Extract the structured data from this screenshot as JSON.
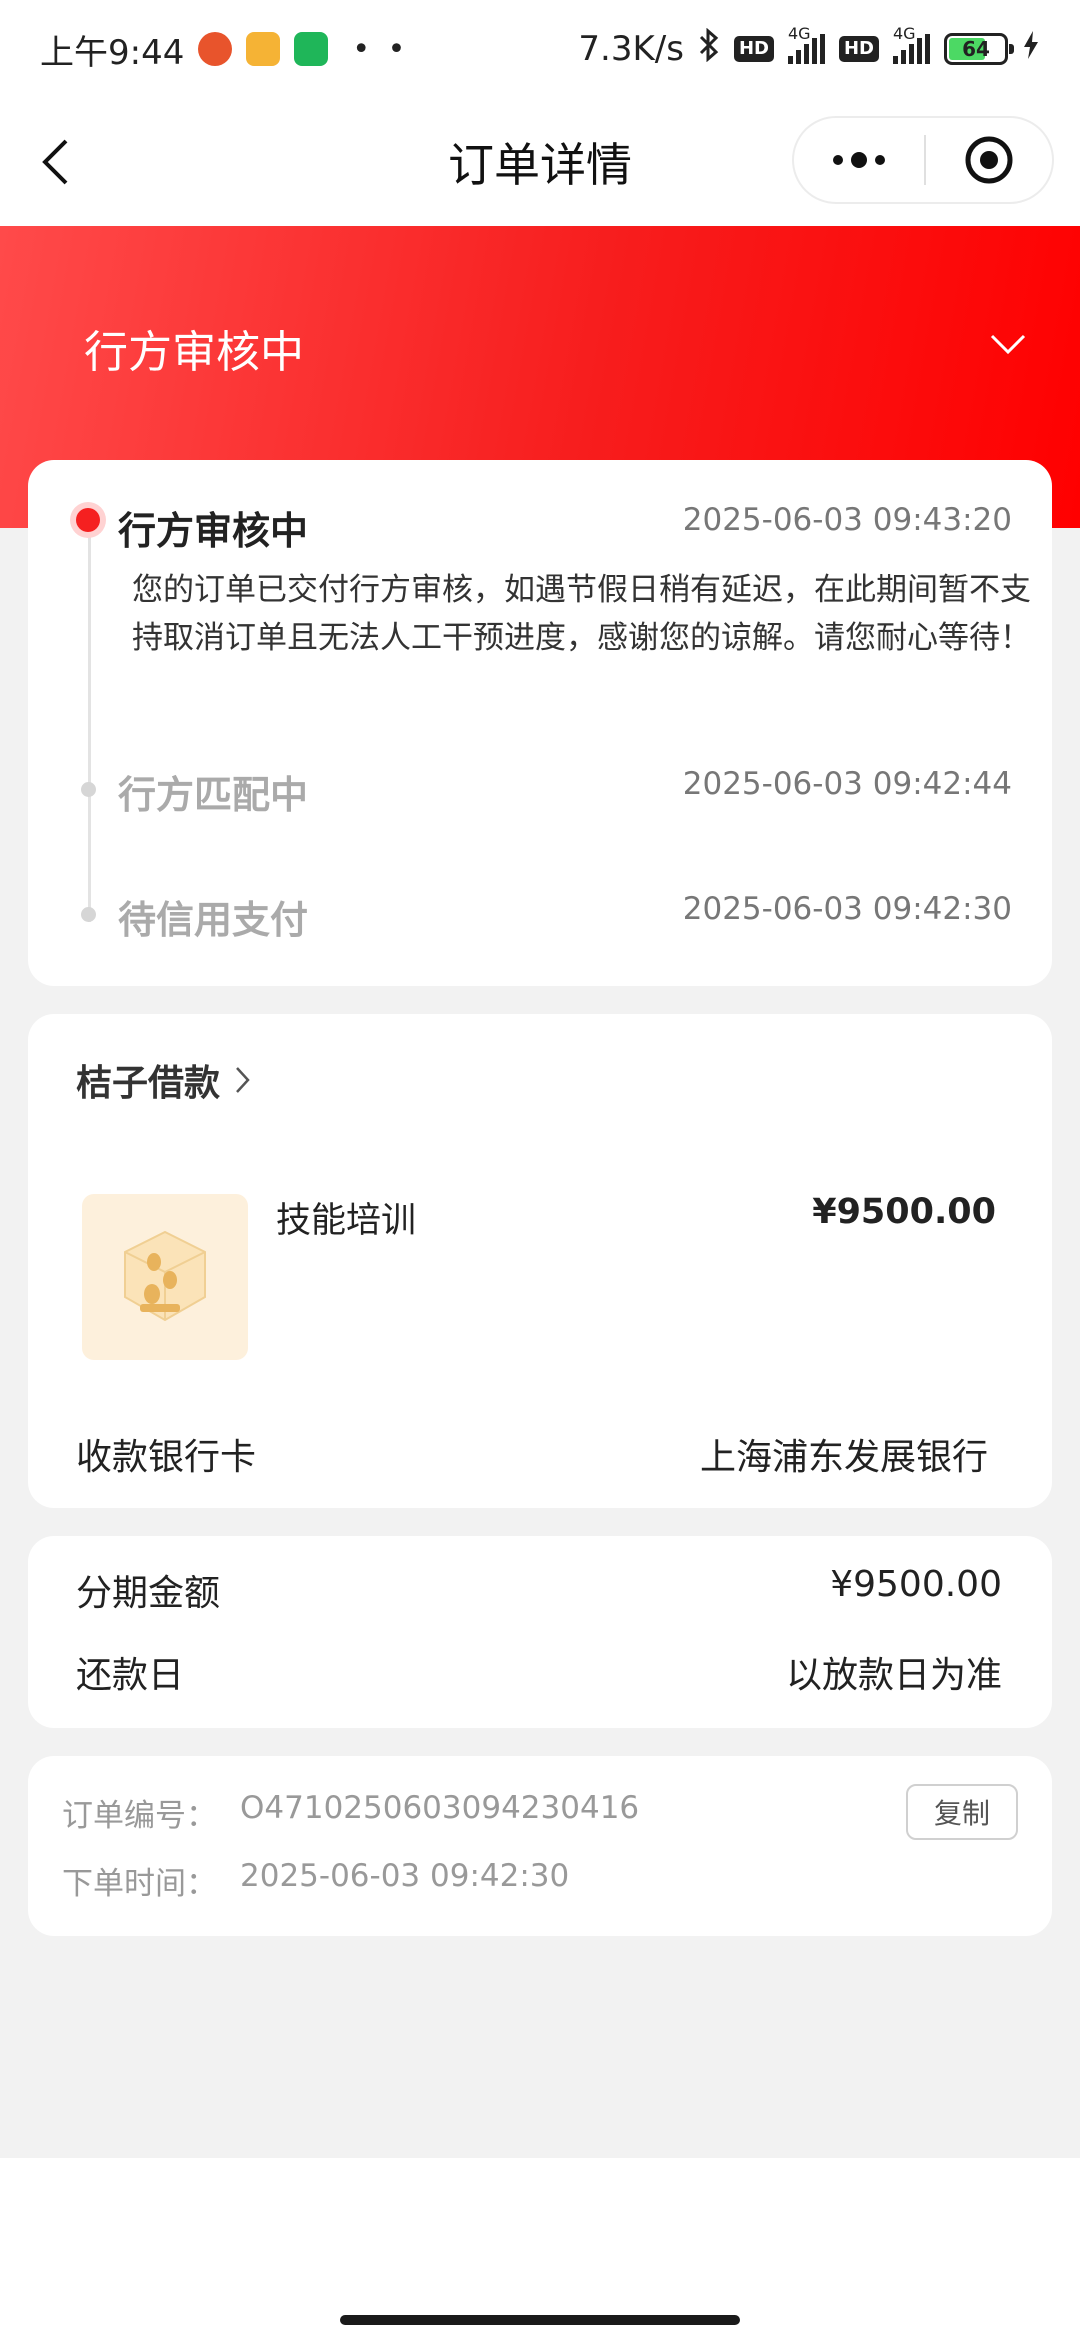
{
  "status_bar": {
    "time": "上午9:44",
    "speed": "7.3K/s",
    "hd": "HD",
    "net": "4G",
    "battery": "64"
  },
  "header": {
    "title": "订单详情"
  },
  "status_banner": {
    "title": "行方审核中"
  },
  "timeline": [
    {
      "title": "行方审核中",
      "time": "2025-06-03 09:43:20",
      "description": "您的订单已交付行方审核，如遇节假日稍有延迟，在此期间暂不支持取消订单且无法人工干预进度，感谢您的谅解。请您耐心等待！"
    },
    {
      "title": "行方匹配中",
      "time": "2025-06-03 09:42:44"
    },
    {
      "title": "待信用支付",
      "time": "2025-06-03 09:42:30"
    }
  ],
  "product": {
    "merchant": "桔子借款",
    "name": "技能培训",
    "price": "¥9500.00",
    "bank_label": "收款银行卡",
    "bank_value": "上海浦东发展银行"
  },
  "installment": {
    "amount_label": "分期金额",
    "amount_value": "¥9500.00",
    "repay_label": "还款日",
    "repay_value": "以放款日为准"
  },
  "order": {
    "number_label": "订单编号：",
    "number_value": "O4710250603094230416",
    "time_label": "下单时间：",
    "time_value": "2025-06-03 09:42:30",
    "copy_label": "复制"
  },
  "colors": {
    "accent_red": "#f52020",
    "header_gradient_start": "#ff4a4a",
    "header_gradient_end": "#ff0000"
  }
}
